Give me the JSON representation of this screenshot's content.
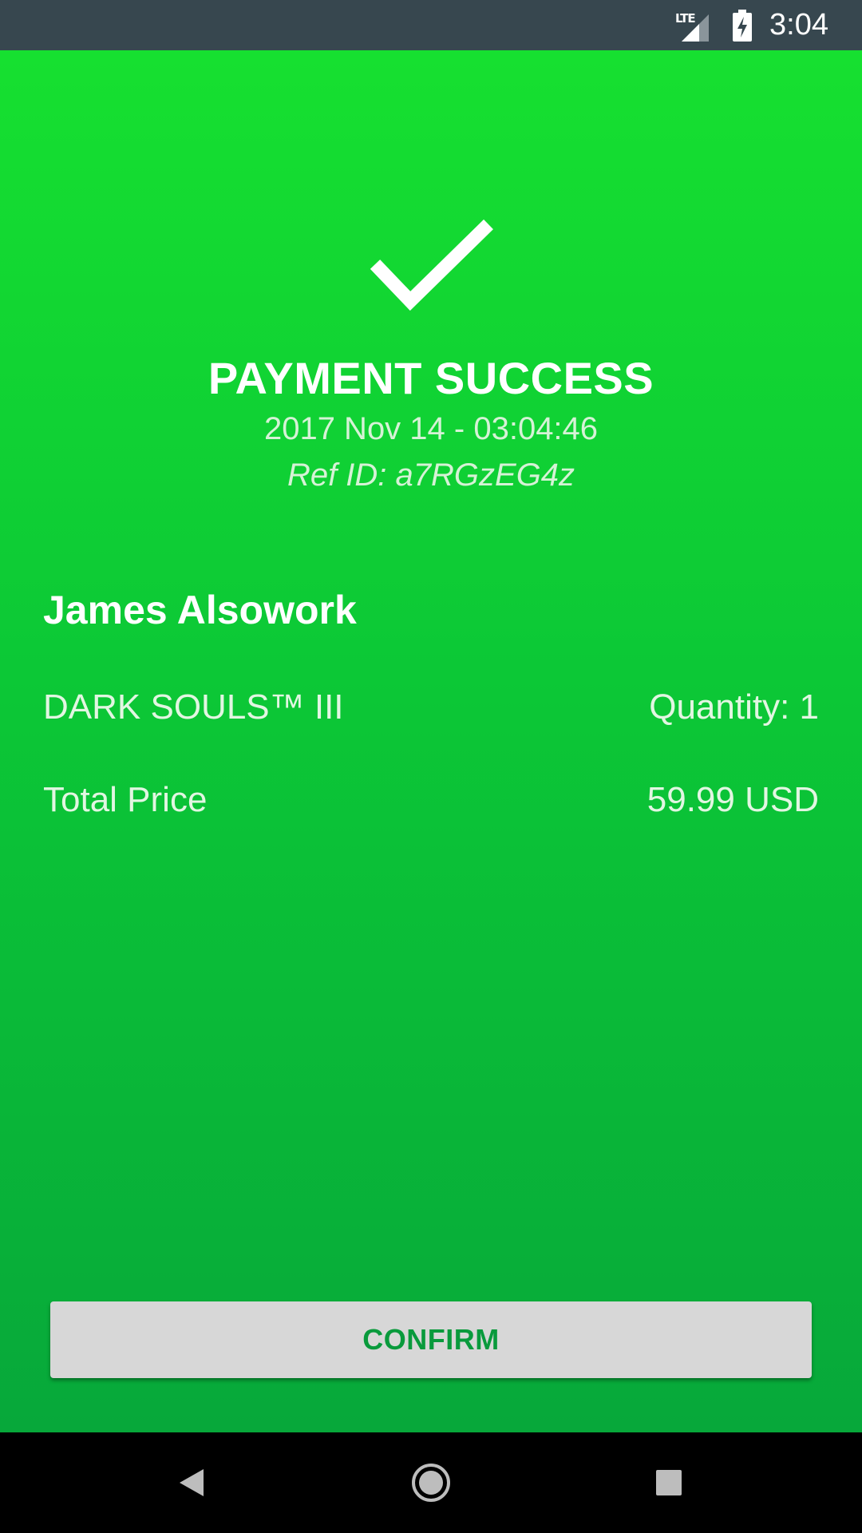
{
  "status_bar": {
    "network_label": "LTE",
    "time": "3:04",
    "background_color": "#37474f",
    "icons": [
      "lte-signal-icon",
      "battery-charging-icon"
    ]
  },
  "payment": {
    "status_icon": "check-icon",
    "title": "PAYMENT SUCCESS",
    "timestamp": "2017 Nov 14 - 03:04:46",
    "ref_id": "Ref ID: a7RGzEG4z",
    "customer_name": "James Alsowork",
    "product_name": "DARK SOULS™ III",
    "quantity": "Quantity: 1",
    "total_label": "Total Price",
    "total_value": "59.99 USD"
  },
  "actions": {
    "confirm_label": "CONFIRM"
  },
  "colors": {
    "background_top": "#16e030",
    "background_bottom": "#07a83a",
    "button_background": "#d7d7d7",
    "button_text": "#099a3c"
  },
  "nav_bar": {
    "icons": [
      "back-icon",
      "home-icon",
      "recents-icon"
    ]
  }
}
